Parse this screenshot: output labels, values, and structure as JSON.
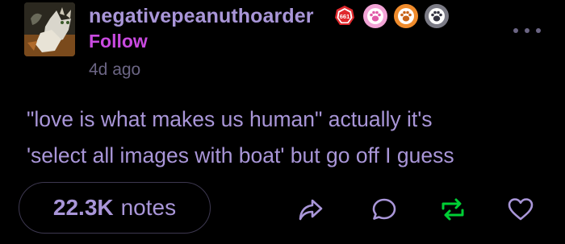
{
  "post": {
    "username": "negativepeanuthoarder",
    "follow_label": "Follow",
    "timestamp": "4d ago",
    "badge_counter_text": "661",
    "body_lines": [
      "\"love is what makes us human\" actually it's",
      "'select all images with boat' but go off I guess"
    ],
    "notes_count": "22.3K",
    "notes_label": "notes"
  },
  "icons": {
    "avatar": "cat-avatar",
    "badges": [
      "counter-badge",
      "paw-badge-pink",
      "paw-badge-orange",
      "paw-badge-gray"
    ],
    "more": "more-dots-icon",
    "share": "share-icon",
    "reply": "reply-icon",
    "reblog": "reblog-icon",
    "like": "heart-icon"
  },
  "colors": {
    "background": "#000000",
    "text": "#a996d8",
    "follow": "#c94ae0",
    "muted": "#6b6584",
    "reblog_active": "#00cf35",
    "badge_red": "#e0292e",
    "badge_pink": "#f2a3d6",
    "badge_orange": "#ef8b2c",
    "badge_gray": "#7b7b86"
  }
}
